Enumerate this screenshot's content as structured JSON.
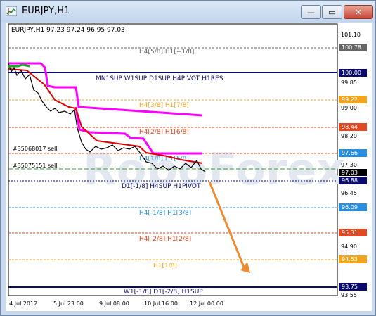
{
  "window": {
    "title": "EURJPY,H1",
    "buttons": {
      "minimize": "—",
      "restore": "▭",
      "close": "✕"
    }
  },
  "chart": {
    "header": "EURJPY,H1  97.23 97.24 96.95 97.03",
    "watermark": "RoboForex",
    "y_ticks": [
      "101.10",
      "100.78",
      "100.00",
      "99.22",
      "99.00",
      "98.44",
      "97.66",
      "97.03",
      "96.88",
      "96.09",
      "95.31",
      "94.53",
      "93.75",
      "93.55",
      "94.90",
      "96.45",
      "97.30",
      "98.20",
      "99.85"
    ],
    "x_ticks": [
      "4 Jul 2012",
      "5 Jul 23:00",
      "9 Jul 08:00",
      "10 Jul 16:00",
      "12 Jul 00:00"
    ],
    "level_labels": [
      "H4[5/8] H1[+1/8]",
      "MN1SUP W1SUP D1SUP H4PIVOT H1RES",
      "H4[3/8] H1[7/8]",
      "H4[2/8] H1[6/8]",
      "H4[1/8] H1[5/8]",
      "D1[-1/8] H4SUP H1PIVOT",
      "H4[-1/8] H1[3/8]",
      "H4[-2/8] H1[2/8]",
      "H1[1/8]",
      "W1[-1/8] D1[-2/8] H1SUP"
    ],
    "orders": [
      "#35068017 sell",
      "#35075151 sell"
    ],
    "colors": {
      "navy": "#0b0b6e",
      "orange": "#f4a31d",
      "red": "#e04a22",
      "blue": "#2b8de0",
      "magenta": "#ff00ff",
      "grey": "#666666",
      "arrow": "#f08a2f",
      "green": "#22a52c"
    }
  },
  "chart_data": {
    "type": "line",
    "title": "EURJPY,H1",
    "ohlc": {
      "open": 97.23,
      "high": 97.24,
      "low": 96.95,
      "close": 97.03
    },
    "x": [
      "4 Jul 2012",
      "5 Jul 23:00",
      "9 Jul 08:00",
      "10 Jul 16:00",
      "12 Jul 00:00"
    ],
    "series": [
      {
        "name": "EURJPY",
        "values": [
          100.1,
          99.5,
          98.9,
          98.5,
          98.1,
          97.6,
          97.2,
          97.03
        ]
      }
    ],
    "ylim": [
      93.55,
      101.3
    ],
    "levels": [
      100.78,
      100.0,
      99.22,
      98.44,
      97.66,
      97.03,
      96.88,
      96.09,
      95.31,
      94.53,
      93.75
    ]
  }
}
